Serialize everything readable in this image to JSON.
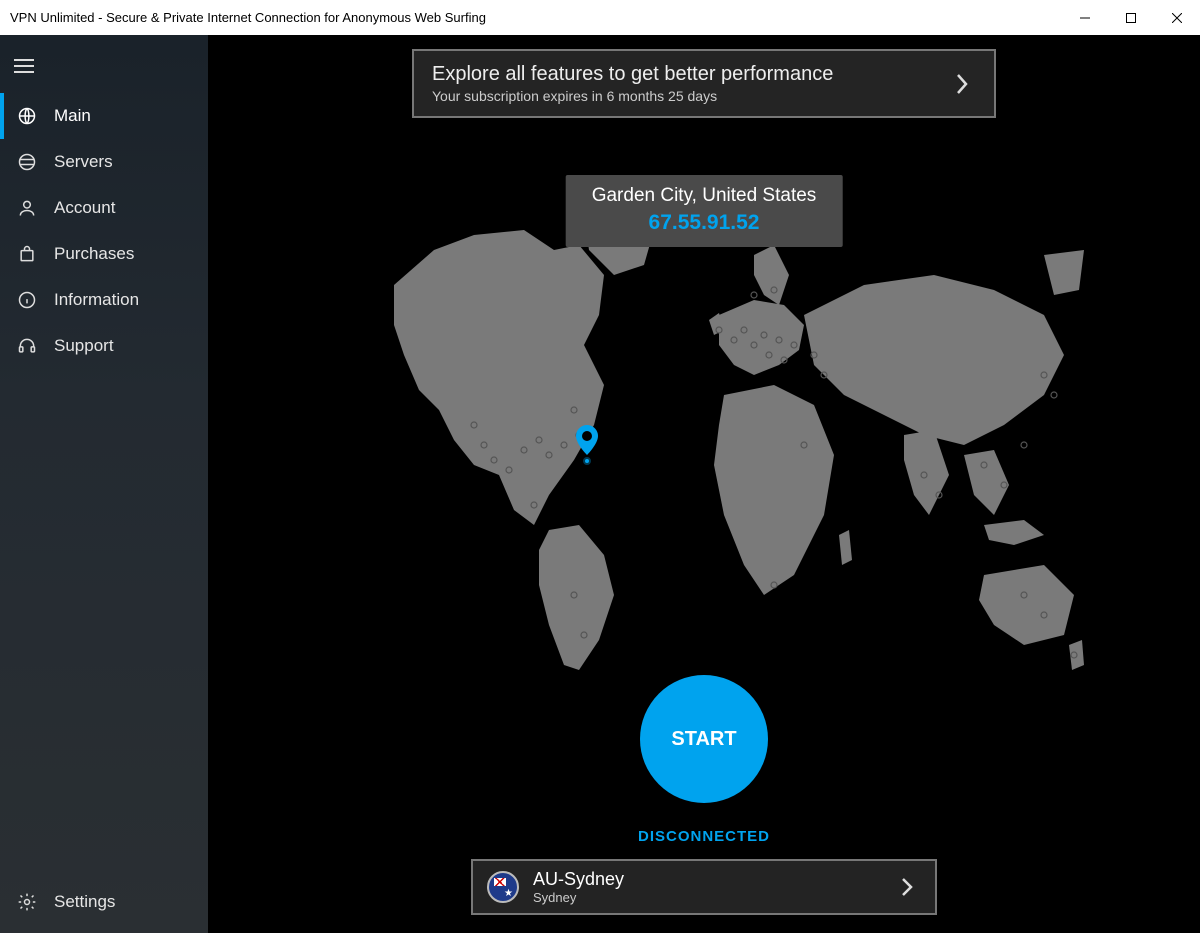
{
  "window": {
    "title": "VPN Unlimited - Secure & Private Internet Connection for Anonymous Web Surfing"
  },
  "sidebar": {
    "items": [
      {
        "label": "Main"
      },
      {
        "label": "Servers"
      },
      {
        "label": "Account"
      },
      {
        "label": "Purchases"
      },
      {
        "label": "Information"
      },
      {
        "label": "Support"
      }
    ],
    "settings_label": "Settings"
  },
  "banner": {
    "title": "Explore all features to get better performance",
    "subtitle": "Your subscription expires in 6 months 25 days"
  },
  "location": {
    "city": "Garden City, United States",
    "ip": "67.55.91.52"
  },
  "connect": {
    "button_label": "START",
    "status": "DISCONNECTED"
  },
  "server": {
    "name": "AU-Sydney",
    "city": "Sydney"
  },
  "colors": {
    "accent": "#00a3ee"
  }
}
